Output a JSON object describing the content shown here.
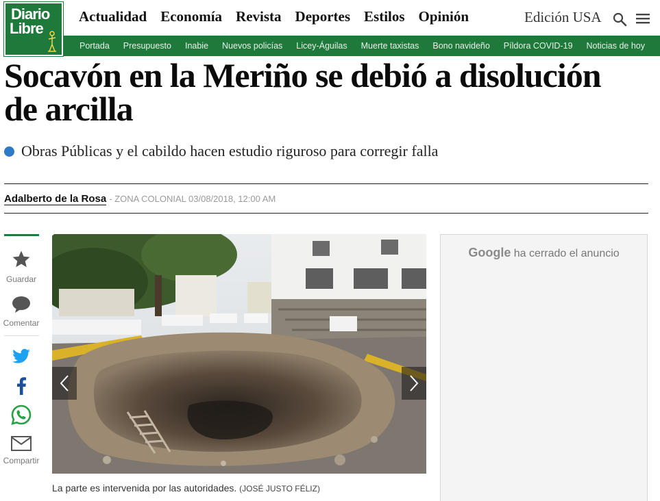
{
  "header": {
    "logo": {
      "line1": "Diario",
      "line2": "Libre"
    },
    "nav": [
      "Actualidad",
      "Economía",
      "Revista",
      "Deportes",
      "Estilos",
      "Opinión"
    ],
    "edition": "Edición USA",
    "subnav": [
      "Portada",
      "Presupuesto",
      "Inabie",
      "Nuevos policías",
      "Licey-Águilas",
      "Muerte taxistas",
      "Bono navideño",
      "Píldora COVID-19",
      "Noticias de hoy"
    ]
  },
  "article": {
    "headline_line1": "Socavón en la Meriño se debió a disolución",
    "headline_line2": "de arcilla",
    "dek": "Obras Públicas y el cabildo hacen estudio riguroso para corregir falla",
    "author": "Adalberto de la Rosa",
    "meta": "- ZONA COLONIAL 03/08/2018, 12:00 AM",
    "caption": "La parte es intervenida por las autoridades.",
    "caption_credit": "(JOSÉ JUSTO FÉLIZ)"
  },
  "sidebar": {
    "save_label": "Guardar",
    "comment_label": "Comentar",
    "share_label": "Compartir"
  },
  "ad": {
    "brand": "Google",
    "message": "ha cerrado el anuncio"
  },
  "colors": {
    "brand_green": "#1d7a3b",
    "dot_blue": "#2f7ac7",
    "twitter": "#1da1f2",
    "facebook": "#1b4e9b",
    "whatsapp": "#25a244"
  }
}
